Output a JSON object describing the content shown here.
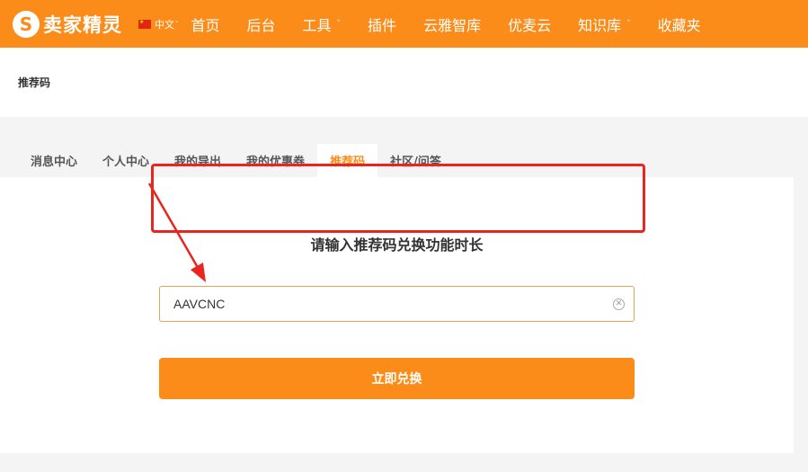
{
  "header": {
    "logo_text": "卖家精灵",
    "logo_letter": "S",
    "language": "中文",
    "nav": [
      {
        "label": "首页",
        "dropdown": false
      },
      {
        "label": "后台",
        "dropdown": false
      },
      {
        "label": "工具",
        "dropdown": true
      },
      {
        "label": "插件",
        "dropdown": false
      },
      {
        "label": "云雅智库",
        "dropdown": false
      },
      {
        "label": "优麦云",
        "dropdown": false
      },
      {
        "label": "知识库",
        "dropdown": true
      },
      {
        "label": "收藏夹",
        "dropdown": false
      }
    ]
  },
  "breadcrumb": "推荐码",
  "tabs": [
    {
      "label": "消息中心",
      "active": false
    },
    {
      "label": "个人中心",
      "active": false
    },
    {
      "label": "我的导出",
      "active": false
    },
    {
      "label": "我的优惠券",
      "active": false
    },
    {
      "label": "推荐码",
      "active": true
    },
    {
      "label": "社区/问答",
      "active": false
    }
  ],
  "form": {
    "headline": "请输入推荐码兑换功能时长",
    "code_value": "AAVCNC",
    "submit_label": "立即兑换"
  },
  "colors": {
    "brand": "#fb8c1a",
    "annotation": "#e8251f"
  }
}
